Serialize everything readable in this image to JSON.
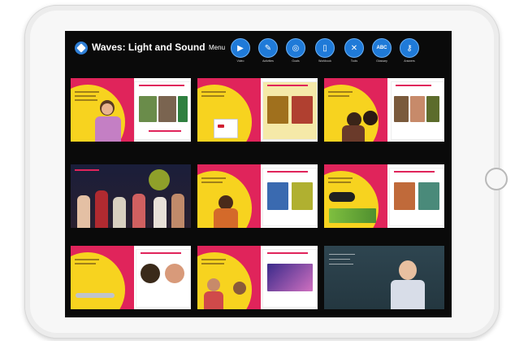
{
  "app": {
    "title": "Waves: Light and Sound",
    "menu_label": "Menu"
  },
  "toolbar": [
    {
      "icon": "play-icon",
      "glyph": "▶",
      "label": "Video"
    },
    {
      "icon": "pen-icon",
      "glyph": "✎",
      "label": "Activities"
    },
    {
      "icon": "target-icon",
      "glyph": "◎",
      "label": "Goals"
    },
    {
      "icon": "book-icon",
      "glyph": "▯",
      "label": "Workbook"
    },
    {
      "icon": "tools-icon",
      "glyph": "✕",
      "label": "Tools"
    },
    {
      "icon": "abc-icon",
      "glyph": "ABC",
      "label": "Glossary"
    },
    {
      "icon": "key-icon",
      "glyph": "⚷",
      "label": "Answers"
    }
  ],
  "colors": {
    "accent_blue": "#1f7ad8",
    "slide_pink": "#e0245b",
    "slide_yellow": "#f7d31f"
  }
}
